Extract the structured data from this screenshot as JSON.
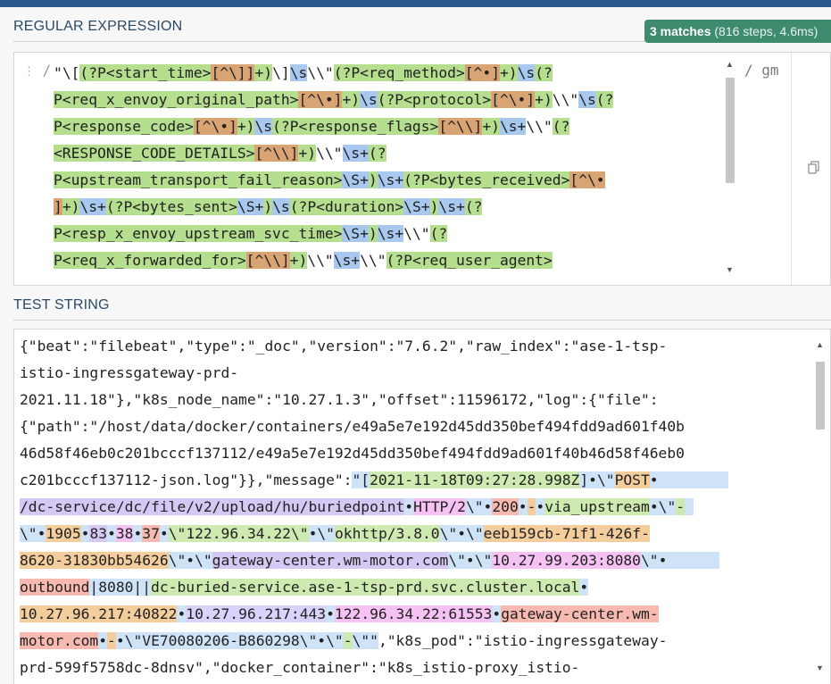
{
  "regex_section": {
    "title": "REGULAR EXPRESSION",
    "match_badge": {
      "count": "3 matches",
      "stats": "(816 steps, 4.6ms)"
    },
    "delimiter_open": "/",
    "delimiter_close": "/",
    "flags": "gm",
    "lines": [
      [
        {
          "t": "\"",
          "c": "plain"
        },
        {
          "t": "\\[",
          "c": "plain"
        },
        {
          "t": "(?P<start_time>",
          "c": "g"
        },
        {
          "t": "[^\\]]",
          "c": "o"
        },
        {
          "t": "+)",
          "c": "g"
        },
        {
          "t": "\\]",
          "c": "plain"
        },
        {
          "t": "\\s",
          "c": "b"
        },
        {
          "t": "\\\\\"",
          "c": "plain"
        },
        {
          "t": "(?P<req_method>",
          "c": "g"
        },
        {
          "t": "[^•]",
          "c": "o"
        },
        {
          "t": "+)",
          "c": "g"
        },
        {
          "t": "\\s",
          "c": "b"
        },
        {
          "t": "(?",
          "c": "g"
        }
      ],
      [
        {
          "t": "P<req_x_envoy_original_path>",
          "c": "g"
        },
        {
          "t": "[^\\•]",
          "c": "o"
        },
        {
          "t": "+)",
          "c": "g"
        },
        {
          "t": "\\s",
          "c": "b"
        },
        {
          "t": "(?P<protocol>",
          "c": "g"
        },
        {
          "t": "[^\\•]",
          "c": "o"
        },
        {
          "t": "+)",
          "c": "g"
        },
        {
          "t": "\\\\\"",
          "c": "plain"
        },
        {
          "t": "\\s",
          "c": "b"
        },
        {
          "t": "(?",
          "c": "g"
        }
      ],
      [
        {
          "t": "P<response_code>",
          "c": "g"
        },
        {
          "t": "[^\\•]",
          "c": "o"
        },
        {
          "t": "+)",
          "c": "g"
        },
        {
          "t": "\\s",
          "c": "b"
        },
        {
          "t": "(?P<response_flags>",
          "c": "g"
        },
        {
          "t": "[^\\\\]",
          "c": "o"
        },
        {
          "t": "+)",
          "c": "g"
        },
        {
          "t": "\\s+",
          "c": "b"
        },
        {
          "t": "\\\\\"",
          "c": "plain"
        },
        {
          "t": "(?",
          "c": "g"
        }
      ],
      [
        {
          "t": "<RESPONSE_CODE_DETAILS>",
          "c": "g"
        },
        {
          "t": "[^\\\\]",
          "c": "o"
        },
        {
          "t": "+)",
          "c": "g"
        },
        {
          "t": "\\\\\"",
          "c": "plain"
        },
        {
          "t": "\\s+",
          "c": "b"
        },
        {
          "t": "(?",
          "c": "g"
        }
      ],
      [
        {
          "t": "P<upstream_transport_fail_reason>",
          "c": "g"
        },
        {
          "t": "\\S+",
          "c": "b"
        },
        {
          "t": ")",
          "c": "g"
        },
        {
          "t": "\\s+",
          "c": "b"
        },
        {
          "t": "(?P<bytes_received>",
          "c": "g"
        },
        {
          "t": "[^\\•",
          "c": "o"
        }
      ],
      [
        {
          "t": "]",
          "c": "o"
        },
        {
          "t": "+)",
          "c": "g"
        },
        {
          "t": "\\s+",
          "c": "b"
        },
        {
          "t": "(?P<bytes_sent>",
          "c": "g"
        },
        {
          "t": "\\S+",
          "c": "b"
        },
        {
          "t": ")",
          "c": "g"
        },
        {
          "t": "\\s",
          "c": "b"
        },
        {
          "t": "(?P<duration>",
          "c": "g"
        },
        {
          "t": "\\S+",
          "c": "b"
        },
        {
          "t": ")",
          "c": "g"
        },
        {
          "t": "\\s+",
          "c": "b"
        },
        {
          "t": "(?",
          "c": "g"
        }
      ],
      [
        {
          "t": "P<resp_x_envoy_upstream_svc_time>",
          "c": "g"
        },
        {
          "t": "\\S+",
          "c": "b"
        },
        {
          "t": ")",
          "c": "g"
        },
        {
          "t": "\\s+",
          "c": "b"
        },
        {
          "t": "\\\\\"",
          "c": "plain"
        },
        {
          "t": "(?",
          "c": "g"
        }
      ],
      [
        {
          "t": "P<req_x_forwarded_for>",
          "c": "g"
        },
        {
          "t": "[^\\\\]",
          "c": "o"
        },
        {
          "t": "+)",
          "c": "g"
        },
        {
          "t": "\\\\\"",
          "c": "plain"
        },
        {
          "t": "\\s+",
          "c": "b"
        },
        {
          "t": "\\\\\"",
          "c": "plain"
        },
        {
          "t": "(?P<req_user_agent>",
          "c": "g"
        }
      ]
    ]
  },
  "test_section": {
    "title": "TEST STRING",
    "lines": [
      [
        {
          "t": "{\"beat\":\"filebeat\",\"type\":\"_doc\",\"version\":\"7.6.2\",\"raw_index\":\"ase-1-tsp-",
          "c": "plain"
        }
      ],
      [
        {
          "t": "istio-ingressgateway-prd-",
          "c": "plain"
        }
      ],
      [
        {
          "t": "2021.11.18\"},\"k8s_node_name\":\"10.27.1.3\",\"offset\":11596172,\"log\":{\"file\":",
          "c": "plain"
        }
      ],
      [
        {
          "t": "{\"path\":\"/host/data/docker/containers/e49a5e7e192d45dd350bef494fdd9ad601f40b",
          "c": "plain"
        }
      ],
      [
        {
          "t": "46d58f46eb0c201bcccf137112/e49a5e7e192d45dd350bef494fdd9ad601f40b46d58f46eb0",
          "c": "plain"
        }
      ],
      [
        {
          "t": "c201bcccf137112-json.log\"}},\"message\":",
          "c": "plain"
        },
        {
          "t": "\"[",
          "c": "m-blue"
        },
        {
          "t": "2021-11-18T09:27:28.998Z",
          "c": "m-green"
        },
        {
          "t": "]•\\\"",
          "c": "m-blue"
        },
        {
          "t": "POST",
          "c": "m-orange"
        },
        {
          "t": "•        ",
          "c": "m-blue"
        }
      ],
      [
        {
          "t": "/dc-service/dc/file/v2/upload/hu/buriedpoint",
          "c": "m-violet"
        },
        {
          "t": "•",
          "c": "m-blue"
        },
        {
          "t": "HTTP/2",
          "c": "m-pink"
        },
        {
          "t": "\\\"•",
          "c": "m-blue"
        },
        {
          "t": "200",
          "c": "m-red"
        },
        {
          "t": "•",
          "c": "m-blue"
        },
        {
          "t": "-",
          "c": "m-orange"
        },
        {
          "t": "•",
          "c": "m-blue"
        },
        {
          "t": "via_upstream",
          "c": "m-green"
        },
        {
          "t": "•\\\"",
          "c": "m-blue"
        },
        {
          "t": "-",
          "c": "m-green"
        },
        {
          "t": " ",
          "c": "m-blue"
        }
      ],
      [
        {
          "t": "\\\"•",
          "c": "m-blue"
        },
        {
          "t": "1905",
          "c": "m-orange"
        },
        {
          "t": "•",
          "c": "m-blue"
        },
        {
          "t": "83",
          "c": "m-violet"
        },
        {
          "t": "•",
          "c": "m-blue"
        },
        {
          "t": "38",
          "c": "m-pink"
        },
        {
          "t": "•",
          "c": "m-blue"
        },
        {
          "t": "37",
          "c": "m-red"
        },
        {
          "t": "•",
          "c": "m-blue"
        },
        {
          "t": "\\\"122.96.34.22\\\"",
          "c": "m-green"
        },
        {
          "t": "•\\\"",
          "c": "m-blue"
        },
        {
          "t": "okhttp/3.8.0",
          "c": "m-green"
        },
        {
          "t": "\\\"•\\\"",
          "c": "m-blue"
        },
        {
          "t": "eeb159cb-71f1-426f-",
          "c": "m-orange"
        }
      ],
      [
        {
          "t": "8620-31830bb54626",
          "c": "m-orange"
        },
        {
          "t": "\\\"•\\\"",
          "c": "m-blue"
        },
        {
          "t": "gateway-center.wm-motor.com",
          "c": "m-violet"
        },
        {
          "t": "\\\"•\\\"",
          "c": "m-blue"
        },
        {
          "t": "10.27.99.203:8080",
          "c": "m-pink"
        },
        {
          "t": "\\\"•      ",
          "c": "m-blue"
        }
      ],
      [
        {
          "t": "outbound",
          "c": "m-red"
        },
        {
          "t": "|8080||",
          "c": "m-blue"
        },
        {
          "t": "dc-buried-service.ase-1-tsp-prd.svc.cluster.local",
          "c": "m-green"
        },
        {
          "t": "•",
          "c": "m-blue"
        }
      ],
      [
        {
          "t": "10.27.96.217:40822",
          "c": "m-orange"
        },
        {
          "t": "•",
          "c": "m-blue"
        },
        {
          "t": "10.27.96.217:443",
          "c": "m-lav"
        },
        {
          "t": "•",
          "c": "m-blue"
        },
        {
          "t": "122.96.34.22:61553",
          "c": "m-pink"
        },
        {
          "t": "•",
          "c": "m-blue"
        },
        {
          "t": "gateway-center.wm-",
          "c": "m-red"
        }
      ],
      [
        {
          "t": "motor.com",
          "c": "m-red"
        },
        {
          "t": "•",
          "c": "m-blue"
        },
        {
          "t": "-",
          "c": "m-orange"
        },
        {
          "t": "•\\\"VE70080206-B860298\\\"•\\\"",
          "c": "m-blue"
        },
        {
          "t": "-",
          "c": "m-green"
        },
        {
          "t": "\\\"\"",
          "c": "m-blue"
        },
        {
          "t": ",\"k8s_pod\":\"istio-ingressgateway-",
          "c": "plain"
        }
      ],
      [
        {
          "t": "prd-599f5758dc-8dnsv\",\"docker_container\":\"k8s_istio-proxy_istio-",
          "c": "plain"
        }
      ]
    ]
  },
  "colors": {
    "accent_green": "#3e8b6e",
    "topbar": "#2d5a8c"
  }
}
